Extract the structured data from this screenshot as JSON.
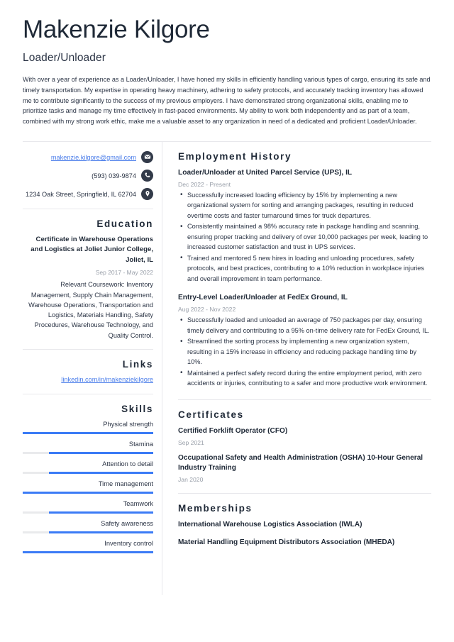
{
  "header": {
    "name": "Makenzie Kilgore",
    "job_title": "Loader/Unloader",
    "summary": "With over a year of experience as a Loader/Unloader, I have honed my skills in efficiently handling various types of cargo, ensuring its safe and timely transportation. My expertise in operating heavy machinery, adhering to safety protocols, and accurately tracking inventory has allowed me to contribute significantly to the success of my previous employers. I have demonstrated strong organizational skills, enabling me to prioritize tasks and manage my time effectively in fast-paced environments. My ability to work both independently and as part of a team, combined with my strong work ethic, make me a valuable asset to any organization in need of a dedicated and proficient Loader/Unloader."
  },
  "contact": {
    "email": "makenzie.kilgore@gmail.com",
    "email_icon": "envelope-icon",
    "phone": "(593) 039-9874",
    "phone_icon": "phone-icon",
    "address": "1234 Oak Street, Springfield, IL 62704",
    "address_icon": "location-pin-icon"
  },
  "education": {
    "heading": "Education",
    "entries": [
      {
        "title": "Certificate in Warehouse Operations and Logistics at Joliet Junior College, Joliet, IL",
        "date": "Sep 2017 - May 2022",
        "description": "Relevant Coursework: Inventory Management, Supply Chain Management, Warehouse Operations, Transportation and Logistics, Materials Handling, Safety Procedures, Warehouse Technology, and Quality Control."
      }
    ]
  },
  "links": {
    "heading": "Links",
    "items": [
      {
        "label": "linkedin.com/in/makenziekilgore"
      }
    ]
  },
  "skills": {
    "heading": "Skills",
    "bar_color": "#3b7bf6",
    "track_color": "#e9eaec",
    "items": [
      {
        "label": "Physical strength",
        "level": 100
      },
      {
        "label": "Stamina",
        "level": 80
      },
      {
        "label": "Attention to detail",
        "level": 80
      },
      {
        "label": "Time management",
        "level": 100
      },
      {
        "label": "Teamwork",
        "level": 80
      },
      {
        "label": "Safety awareness",
        "level": 80
      },
      {
        "label": "Inventory control",
        "level": 100
      }
    ]
  },
  "employment": {
    "heading": "Employment History",
    "jobs": [
      {
        "title": "Loader/Unloader at United Parcel Service (UPS), IL",
        "date": "Dec 2022 - Present",
        "bullets": [
          "Successfully increased loading efficiency by 15% by implementing a new organizational system for sorting and arranging packages, resulting in reduced overtime costs and faster turnaround times for truck departures.",
          "Consistently maintained a 98% accuracy rate in package handling and scanning, ensuring proper tracking and delivery of over 10,000 packages per week, leading to increased customer satisfaction and trust in UPS services.",
          "Trained and mentored 5 new hires in loading and unloading procedures, safety protocols, and best practices, contributing to a 10% reduction in workplace injuries and overall improvement in team performance."
        ]
      },
      {
        "title": "Entry-Level Loader/Unloader at FedEx Ground, IL",
        "date": "Aug 2022 - Nov 2022",
        "bullets": [
          "Successfully loaded and unloaded an average of 750 packages per day, ensuring timely delivery and contributing to a 95% on-time delivery rate for FedEx Ground, IL.",
          "Streamlined the sorting process by implementing a new organization system, resulting in a 15% increase in efficiency and reducing package handling time by 10%.",
          "Maintained a perfect safety record during the entire employment period, with zero accidents or injuries, contributing to a safer and more productive work environment."
        ]
      }
    ]
  },
  "certificates": {
    "heading": "Certificates",
    "items": [
      {
        "name": "Certified Forklift Operator (CFO)",
        "date": "Sep 2021"
      },
      {
        "name": "Occupational Safety and Health Administration (OSHA) 10-Hour General Industry Training",
        "date": "Jan 2020"
      }
    ]
  },
  "memberships": {
    "heading": "Memberships",
    "items": [
      {
        "name": "International Warehouse Logistics Association (IWLA)"
      },
      {
        "name": "Material Handling Equipment Distributors Association (MHEDA)"
      }
    ]
  }
}
